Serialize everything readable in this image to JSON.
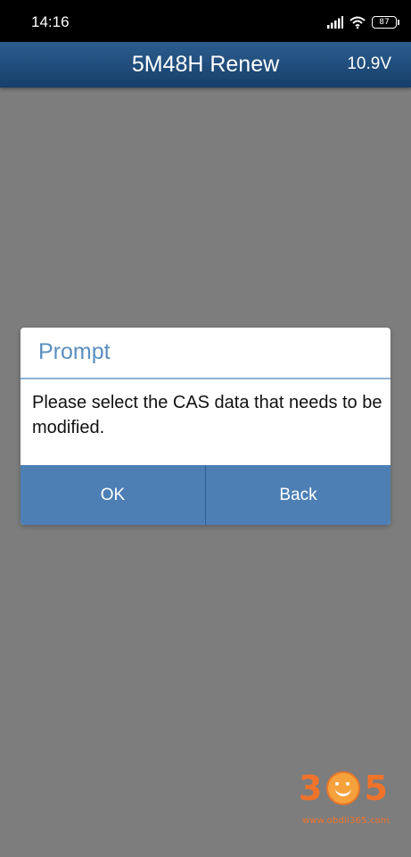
{
  "status_bar": {
    "time": "14:16",
    "battery_level": "87",
    "icons": [
      "signal-icon",
      "wifi-icon",
      "battery-icon"
    ]
  },
  "header": {
    "title": "5M48H Renew",
    "voltage": "10.9V"
  },
  "dialog": {
    "title": "Prompt",
    "message": "Please select the CAS data that needs to be modified.",
    "ok_label": "OK",
    "back_label": "Back"
  },
  "watermark": {
    "logo_text": "365",
    "url": "www.obdii365.com"
  },
  "colors": {
    "header_bg": "#1f4d7d",
    "dialog_title": "#5b8fbf",
    "button_bg": "#4d7fb5",
    "overlay_bg": "#7d7d7d",
    "watermark": "#f0732a"
  }
}
